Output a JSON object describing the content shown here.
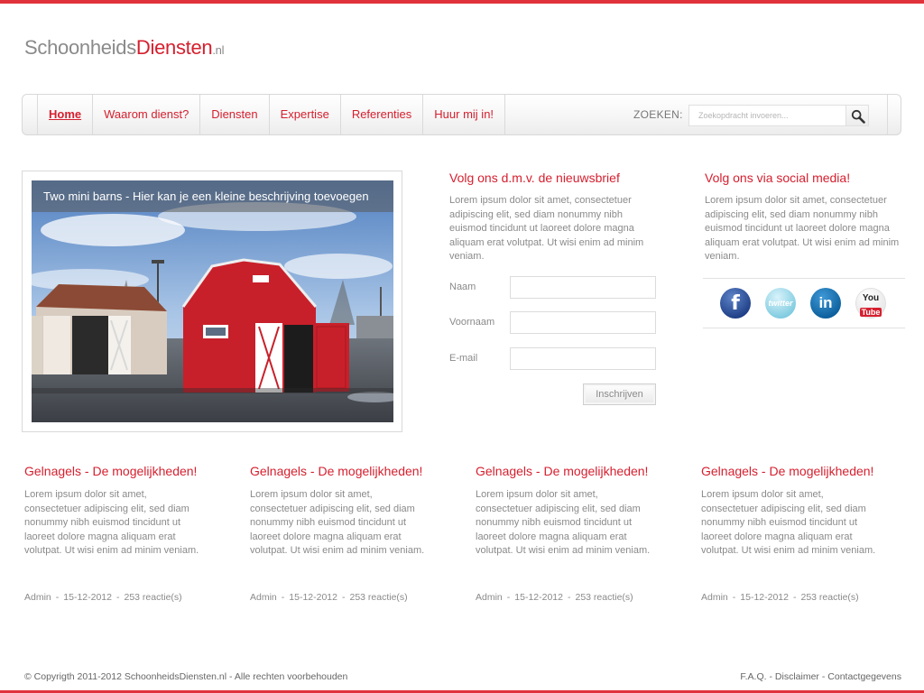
{
  "brand": {
    "logo_part1": "Schoonheids",
    "logo_part2": "Diensten",
    "logo_tld": ".nl",
    "accent_color": "#d5202f"
  },
  "nav": {
    "items": [
      {
        "label": "Home",
        "active": true
      },
      {
        "label": "Waarom dienst?"
      },
      {
        "label": "Diensten"
      },
      {
        "label": "Expertise"
      },
      {
        "label": "Referenties"
      },
      {
        "label": "Huur mij in!"
      }
    ],
    "search_label": "ZOEKEN:",
    "search_placeholder": "Zoekopdracht invoeren...",
    "search_icon": "magnifier-icon"
  },
  "slider": {
    "caption": "Two mini barns - Hier kan je een kleine beschrijving toevoegen"
  },
  "newsletter": {
    "title": "Volg ons d.m.v. de nieuwsbrief",
    "text": "Lorem ipsum dolor sit amet, consectetuer adipiscing elit, sed diam nonummy nibh euismod tincidunt ut laoreet dolore magna aliquam erat volutpat. Ut wisi enim ad minim veniam.",
    "fields": [
      {
        "label": "Naam"
      },
      {
        "label": "Voornaam"
      },
      {
        "label": "E-mail"
      }
    ],
    "button": "Inschrijven"
  },
  "social": {
    "title": "Volg ons via social media!",
    "text": "Lorem ipsum dolor sit amet, consectetuer adipiscing elit, sed diam nonummy nibh euismod tincidunt ut laoreet dolore magna aliquam erat volutpat. Ut wisi enim ad minim veniam.",
    "icons": [
      "facebook-icon",
      "twitter-icon",
      "linkedin-icon",
      "youtube-icon"
    ],
    "facebook_glyph": "f",
    "twitter_glyph": "twitter",
    "linkedin_glyph": "in",
    "youtube_glyph_1": "You",
    "youtube_glyph_2": "Tube"
  },
  "articles": [
    {
      "title": "Gelnagels - De mogelijkheden!",
      "text": "Lorem ipsum dolor sit amet, consectetuer adipiscing elit, sed diam nonummy nibh euismod tincidunt ut laoreet dolore magna aliquam erat volutpat. Ut wisi enim ad minim veniam.",
      "author": "Admin",
      "date": "15-12-2012",
      "comments": "253 reactie(s)"
    },
    {
      "title": "Gelnagels - De mogelijkheden!",
      "text": "Lorem ipsum dolor sit amet, consectetuer adipiscing elit, sed diam nonummy nibh euismod tincidunt ut laoreet dolore magna aliquam erat volutpat. Ut wisi enim ad minim veniam.",
      "author": "Admin",
      "date": "15-12-2012",
      "comments": "253 reactie(s)"
    },
    {
      "title": "Gelnagels - De mogelijkheden!",
      "text": "Lorem ipsum dolor sit amet, consectetuer adipiscing elit, sed diam nonummy nibh euismod tincidunt ut laoreet dolore magna aliquam erat volutpat. Ut wisi enim ad minim veniam.",
      "author": "Admin",
      "date": "15-12-2012",
      "comments": "253 reactie(s)"
    },
    {
      "title": "Gelnagels - De mogelijkheden!",
      "text": "Lorem ipsum dolor sit amet, consectetuer adipiscing elit, sed diam nonummy nibh euismod tincidunt ut laoreet dolore magna aliquam erat volutpat. Ut wisi enim ad minim veniam.",
      "author": "Admin",
      "date": "15-12-2012",
      "comments": "253 reactie(s)"
    }
  ],
  "meta_separator": "-",
  "footer": {
    "copyright": "© Copyrigth 2011-2012 SchoonheidsDiensten.nl - Alle rechten voorbehouden",
    "links": [
      "F.A.Q.",
      "Disclaimer",
      "Contactgegevens"
    ],
    "link_separator": " - "
  }
}
